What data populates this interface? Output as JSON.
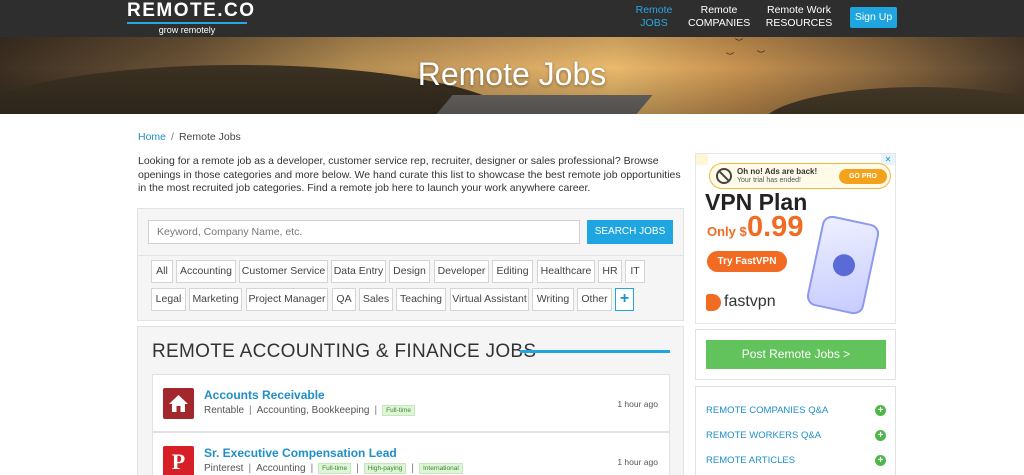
{
  "header": {
    "logo_main": "REMOTE.CO",
    "logo_sub": "grow remotely",
    "nav": [
      {
        "line1": "Remote",
        "line2": "JOBS"
      },
      {
        "line1": "Remote",
        "line2": "COMPANIES"
      },
      {
        "line1": "Remote Work",
        "line2": "RESOURCES"
      }
    ],
    "signup": "Sign Up"
  },
  "hero": {
    "title": "Remote Jobs"
  },
  "breadcrumb": {
    "home": "Home",
    "separator": "/",
    "current": "Remote Jobs"
  },
  "intro": "Looking for a remote job as a developer, customer service rep, recruiter, designer or sales professional? Browse openings in those categories and more below. We hand curate this list to showcase the best remote job opportunities in the most recruited job categories. Find a remote job here to launch your work anywhere career.",
  "search": {
    "placeholder": "Keyword, Company Name, etc.",
    "button": "SEARCH JOBS"
  },
  "categories": {
    "row1": [
      "All",
      "Accounting",
      "Customer Service",
      "Data Entry",
      "Design",
      "Developer",
      "Editing",
      "Healthcare",
      "HR",
      "IT"
    ],
    "row2": [
      "Legal",
      "Marketing",
      "Project Manager",
      "QA",
      "Sales",
      "Teaching",
      "Virtual Assistant",
      "Writing",
      "Other"
    ],
    "plus": "+"
  },
  "section": {
    "title": "REMOTE ACCOUNTING & FINANCE JOBS"
  },
  "jobs": [
    {
      "title": "Accounts Receivable",
      "company": "Rentable",
      "categories": "Accounting, Bookkeeping",
      "tags": [
        "Full-time"
      ],
      "time": "1 hour ago"
    },
    {
      "title": "Sr. Executive Compensation Lead",
      "company": "Pinterest",
      "categories": "Accounting",
      "tags": [
        "Full-time",
        "High-paying",
        "International"
      ],
      "time": "1 hour ago"
    }
  ],
  "ad": {
    "alert_title": "Oh no! Ads are back!",
    "alert_sub": "Your trial has ended!",
    "gopro": "GO PRO",
    "headline": "VPN Plan",
    "price_label": "Only $",
    "price": "0.99",
    "cta": "Try FastVPN",
    "brand": "fastvpn"
  },
  "sidebar": {
    "post_button": "Post Remote Jobs >",
    "links": [
      "REMOTE COMPANIES Q&A",
      "REMOTE WORKERS Q&A",
      "REMOTE ARTICLES"
    ]
  },
  "colors": {
    "accent": "#1fa6e0",
    "header_bg": "#2e2e2e",
    "cta_green": "#62c25b",
    "ad_orange": "#f26b22"
  }
}
